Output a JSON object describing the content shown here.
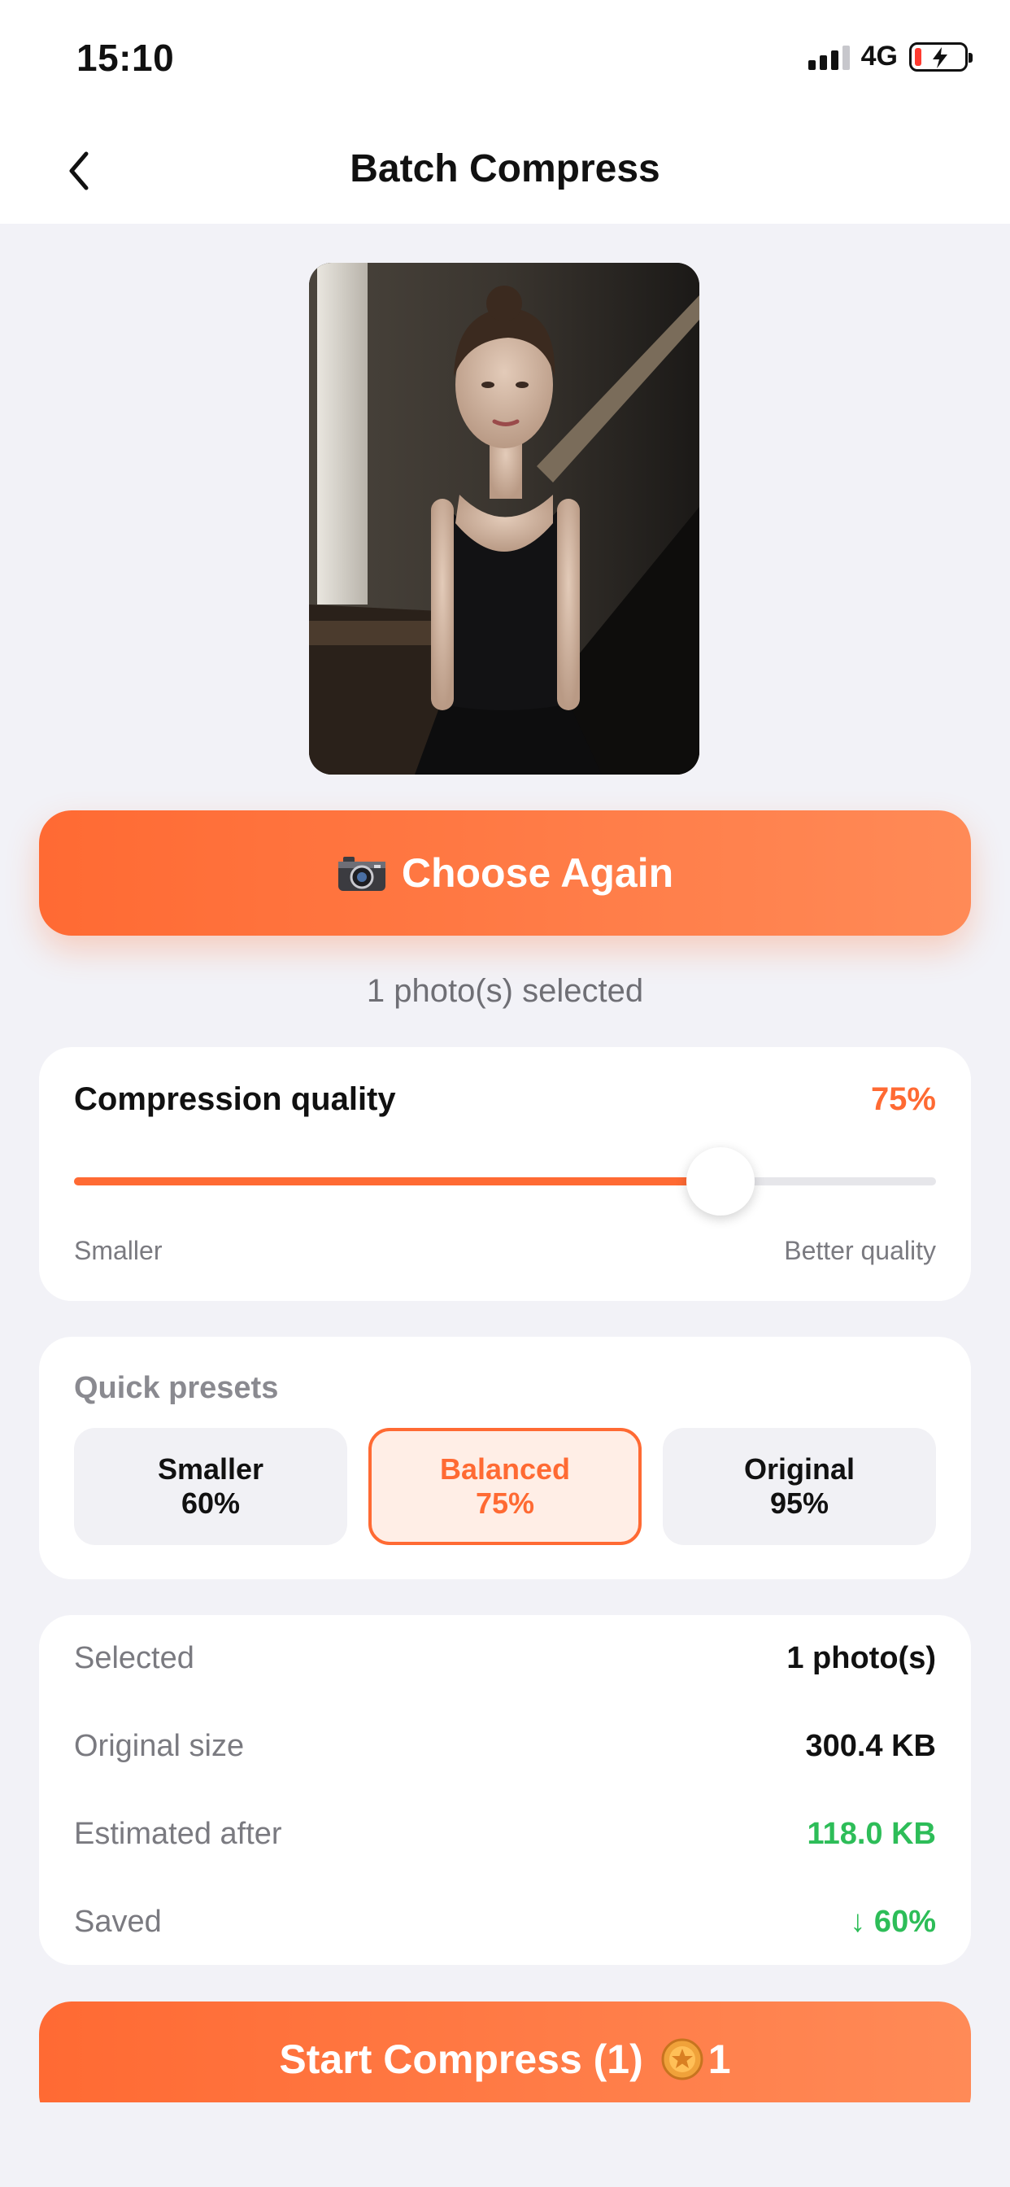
{
  "status_bar": {
    "time": "15:10",
    "network": "4G",
    "battery_level": 0.1,
    "charging": true,
    "signal_bars": 3
  },
  "nav": {
    "title": "Batch Compress",
    "back_icon": "chevron-left-icon"
  },
  "photo": {
    "description_icon": "photo-thumbnail"
  },
  "choose_again": {
    "icon": "camera-icon",
    "label": "Choose Again"
  },
  "selection": {
    "count_text": "1 photo(s) selected"
  },
  "quality": {
    "title": "Compression quality",
    "value_text": "75%",
    "value": 0.75,
    "min_label": "Smaller",
    "max_label": "Better quality"
  },
  "presets": {
    "title": "Quick presets",
    "items": [
      {
        "name": "Smaller",
        "value": "60%",
        "active": false
      },
      {
        "name": "Balanced",
        "value": "75%",
        "active": true
      },
      {
        "name": "Original",
        "value": "95%",
        "active": false
      }
    ]
  },
  "summary": {
    "rows": [
      {
        "label": "Selected",
        "value": "1 photo(s)"
      },
      {
        "label": "Original size",
        "value": "300.4 KB"
      },
      {
        "label": "Estimated after",
        "value": "118.0 KB"
      },
      {
        "label": "Saved",
        "value": "↓ 60%"
      }
    ]
  },
  "start": {
    "label": "Start Compress (1)",
    "cost_icon": "coin-icon",
    "cost": "1"
  },
  "colors": {
    "accent": "#ff6a33",
    "positive": "#2dbd58",
    "background": "#f2f2f7"
  }
}
